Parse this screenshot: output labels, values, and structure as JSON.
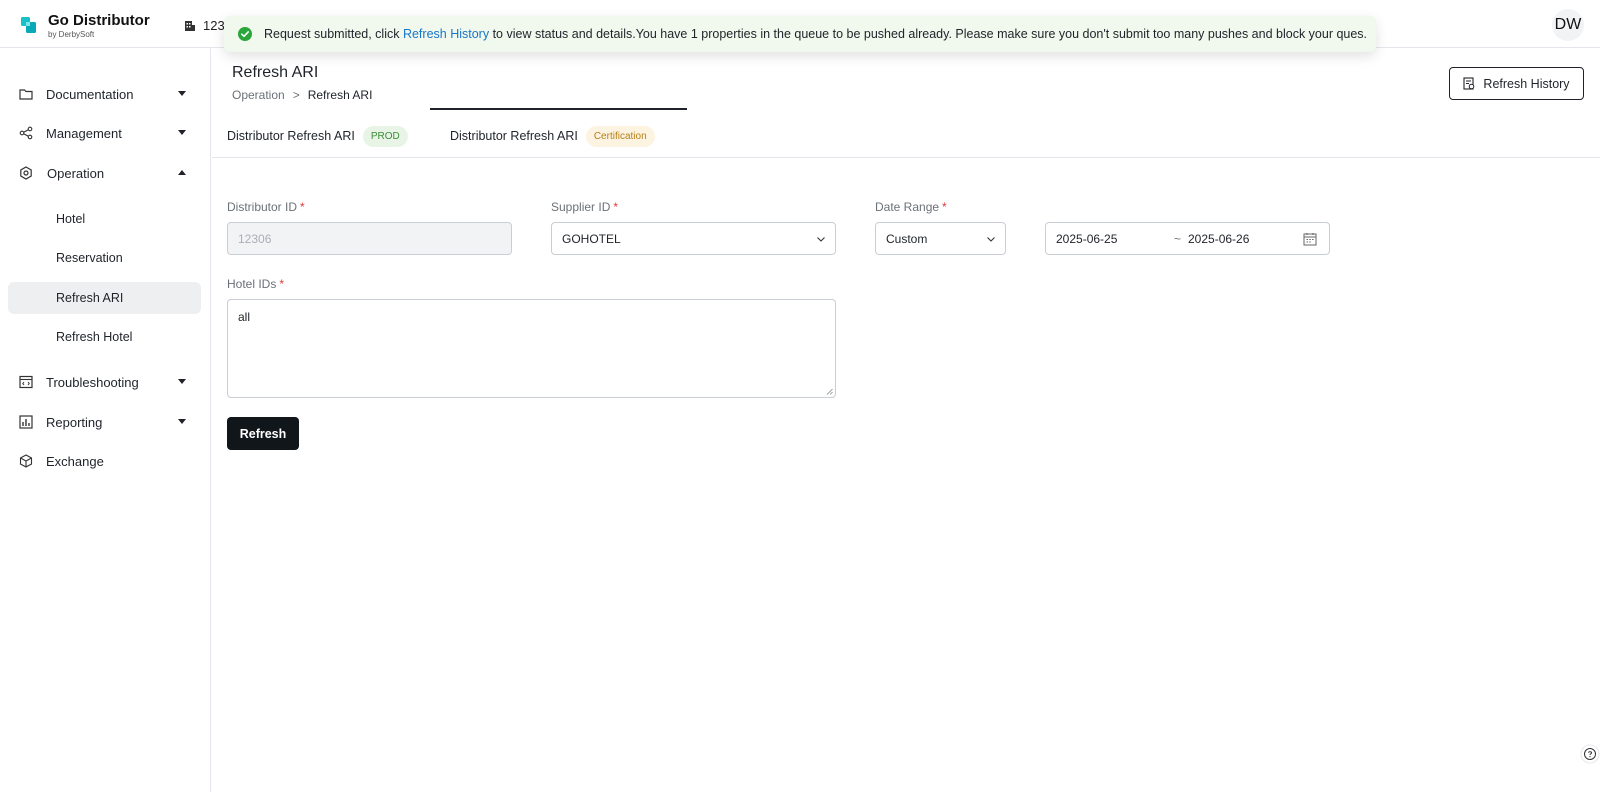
{
  "header": {
    "brand_name": "Go Distributor",
    "brand_sub": "by DerbySoft",
    "distributor_id": "12306",
    "avatar_initials": "DW"
  },
  "toast": {
    "text_before": "Request submitted, click ",
    "link_text": "Refresh History",
    "text_after": " to view status and details.You have 1 properties in the queue to be pushed already. Please make sure you don't submit too many pushes and block your ques."
  },
  "sidebar": {
    "items": [
      {
        "label": "Documentation",
        "icon": "folder-icon"
      },
      {
        "label": "Management",
        "icon": "share-icon"
      },
      {
        "label": "Operation",
        "icon": "gear-icon"
      },
      {
        "label": "Troubleshooting",
        "icon": "code-window-icon"
      },
      {
        "label": "Reporting",
        "icon": "bar-chart-icon"
      },
      {
        "label": "Exchange",
        "icon": "cube-icon"
      }
    ],
    "operation_children": [
      "Hotel",
      "Reservation",
      "Refresh ARI",
      "Refresh Hotel"
    ],
    "active_child": "Refresh ARI"
  },
  "page": {
    "title": "Refresh ARI",
    "breadcrumb": [
      "Operation",
      ">",
      "Refresh ARI"
    ],
    "history_button": "Refresh History"
  },
  "tabs": [
    {
      "label": "Distributor Refresh ARI",
      "badge": "PROD"
    },
    {
      "label": "Distributor Refresh ARI",
      "badge": "Certification"
    }
  ],
  "form": {
    "distributor_id_label": "Distributor ID",
    "distributor_id_value": "12306",
    "supplier_id_label": "Supplier ID",
    "supplier_id_value": "GOHOTEL",
    "date_range_label": "Date Range",
    "date_range_mode": "Custom",
    "date_start": "2025-06-25",
    "date_sep": "~",
    "date_end": "2025-06-26",
    "hotel_ids_label": "Hotel IDs",
    "hotel_ids_value": "all",
    "required_mark": "*",
    "submit_label": "Refresh"
  },
  "colors": {
    "accent": "#11161b",
    "link": "#1677c8",
    "success": "#2aa63a",
    "required": "#e0393e",
    "brand": "#18c0c8"
  }
}
